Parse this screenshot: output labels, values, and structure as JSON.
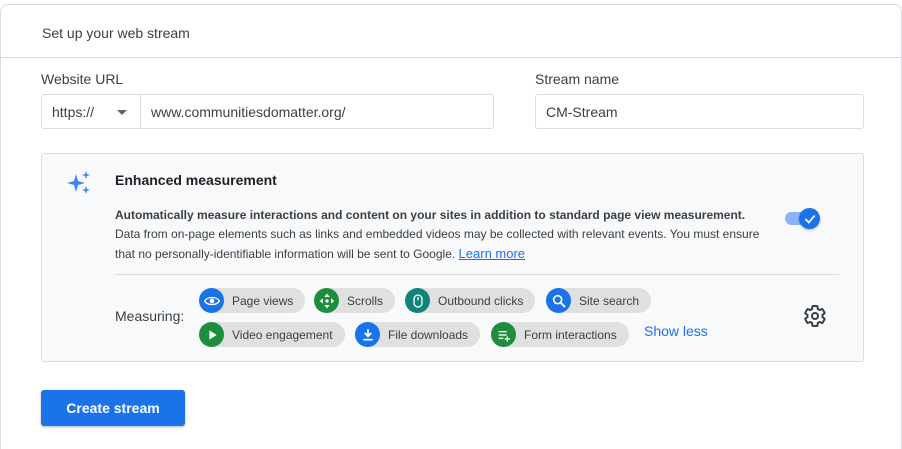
{
  "card": {
    "title": "Set up your web stream"
  },
  "url_field": {
    "label": "Website URL",
    "protocol": "https://",
    "value": "www.communitiesdomatter.org/"
  },
  "name_field": {
    "label": "Stream name",
    "value": "CM-Stream"
  },
  "enhanced": {
    "title": "Enhanced measurement",
    "desc_lead": "Automatically measure interactions and content on your sites in addition to standard page view measurement.",
    "desc_body": "Data from on-page elements such as links and embedded videos may be collected with relevant events. You must ensure that no personally-identifiable information will be sent to Google.",
    "learn_more": "Learn more",
    "enabled": true,
    "measuring_label": "Measuring:",
    "chips": [
      {
        "label": "Page views",
        "icon": "eye-icon",
        "color": "#1a73e8"
      },
      {
        "label": "Scrolls",
        "icon": "scroll-arrows-icon",
        "color": "#1e8e3e"
      },
      {
        "label": "Outbound clicks",
        "icon": "mouse-icon",
        "color": "#12837b"
      },
      {
        "label": "Site search",
        "icon": "search-icon",
        "color": "#1a73e8"
      },
      {
        "label": "Video engagement",
        "icon": "play-icon",
        "color": "#1e8e3e"
      },
      {
        "label": "File downloads",
        "icon": "download-icon",
        "color": "#1a73e8"
      },
      {
        "label": "Form interactions",
        "icon": "form-icon",
        "color": "#1e8e3e"
      }
    ],
    "show_less": "Show less"
  },
  "create_button": "Create stream"
}
